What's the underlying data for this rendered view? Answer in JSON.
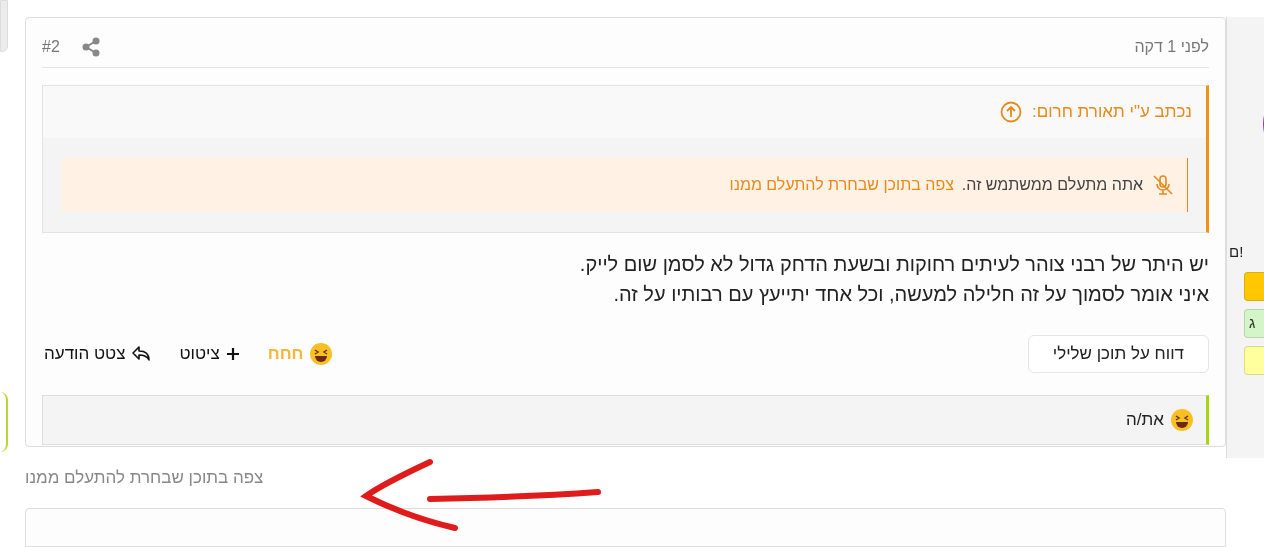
{
  "post": {
    "number": "#2",
    "time": "לפני 1 דקה",
    "quote": {
      "author": "נכתב ע\"י תאורת חרום:",
      "notice": "אתה מתעלם ממשתמש זה.",
      "link": "צפה בתוכן שבחרת להתעלם ממנו"
    },
    "body": [
      "יש היתר של רבני צוהר לעיתים רחוקות ובשעת הדחק גדול לא לסמן שום לייק.",
      "איני אומר לסמוך על זה חלילה למעשה, וכל אחד יתייעץ עם רבותיו על זה."
    ],
    "report_button": "דווח על תוכן שלילי",
    "actions": [
      {
        "kind": "reaction",
        "label": "חחח"
      },
      {
        "kind": "quote",
        "label": "ציטוט"
      },
      {
        "kind": "reply",
        "label": "צטט הודעה"
      }
    ],
    "reactions_bar": {
      "label": "את/ה"
    }
  },
  "ignored_link": "צפה בתוכן שבחרת להתעלם ממנו",
  "sidebar": {
    "heading": "ם!",
    "tags": [
      {
        "color": "#ffc800"
      },
      {
        "label": "ג",
        "color": "#d4f5c8"
      },
      {
        "color": "#ffff9e"
      }
    ]
  }
}
